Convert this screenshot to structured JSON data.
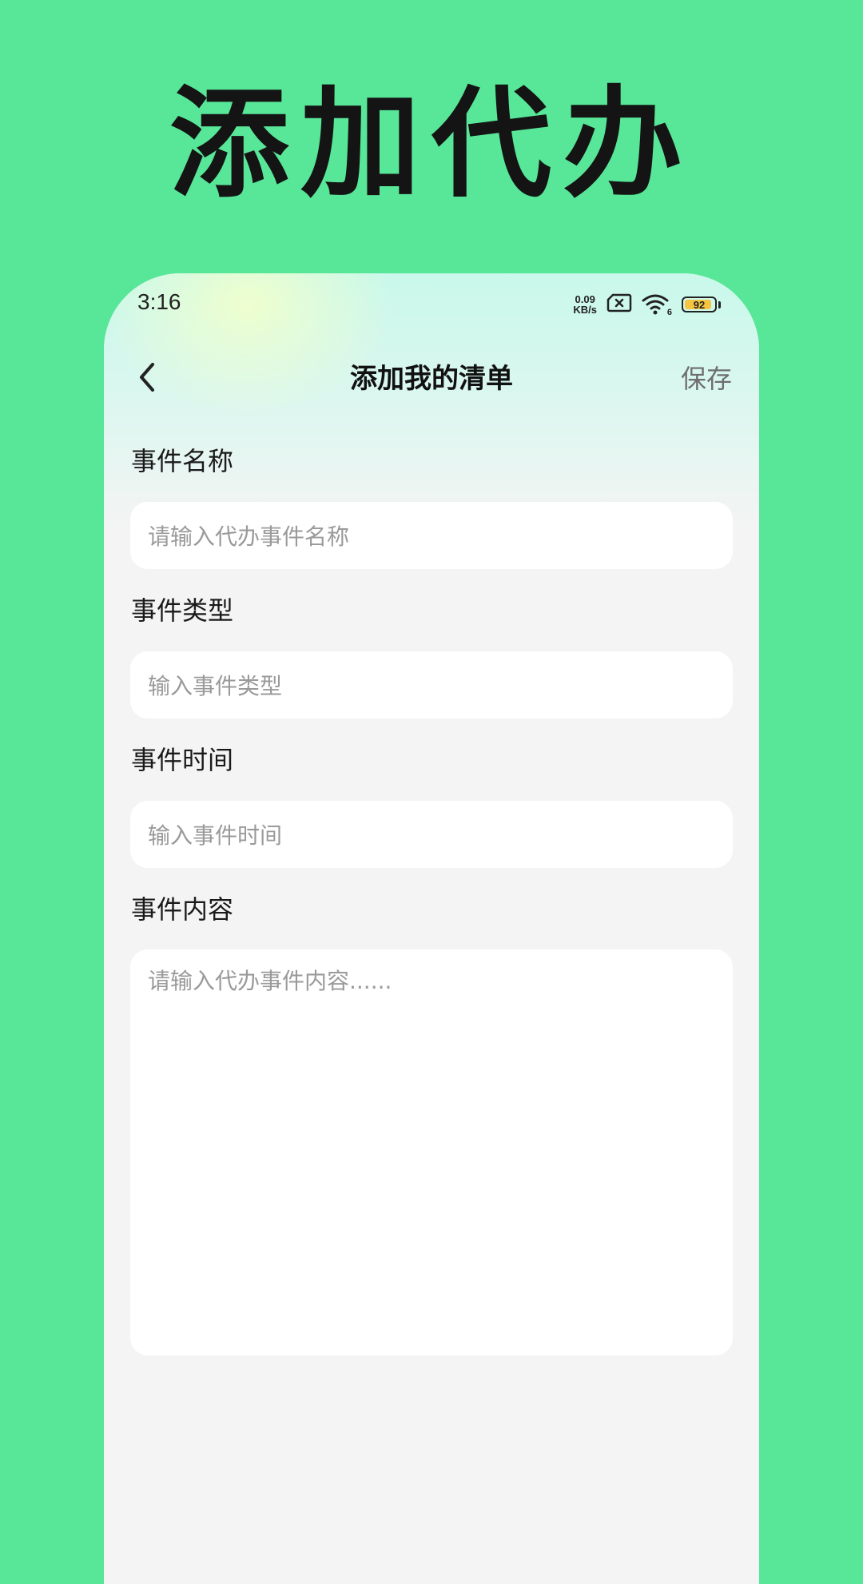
{
  "promo": {
    "title": "添加代办"
  },
  "status_bar": {
    "time": "3:16",
    "net_speed_value": "0.09",
    "net_speed_unit": "KB/s",
    "wifi_label": "6",
    "battery": "92",
    "battery_level": 0.92,
    "icons": [
      "sim-off-icon",
      "wifi-icon",
      "battery-icon"
    ]
  },
  "nav": {
    "back_icon": "chevron-left-icon",
    "title": "添加我的清单",
    "save_label": "保存"
  },
  "form": {
    "name": {
      "label": "事件名称",
      "placeholder": "请输入代办事件名称"
    },
    "type": {
      "label": "事件类型",
      "placeholder": "输入事件类型"
    },
    "time": {
      "label": "事件时间",
      "placeholder": "输入事件时间"
    },
    "content": {
      "label": "事件内容",
      "placeholder": "请输入代办事件内容......"
    }
  },
  "colors": {
    "background": "#58E698",
    "card": "#F4F4F4",
    "input": "#FFFFFF",
    "placeholder": "#9A9A9A",
    "battery_fill": "#F5C542"
  }
}
